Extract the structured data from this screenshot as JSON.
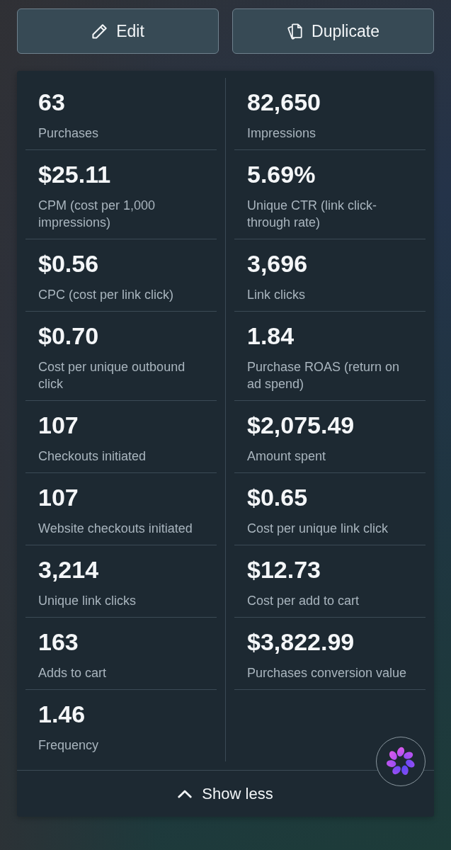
{
  "actions": [
    {
      "kind": "edit",
      "label": "Edit"
    },
    {
      "kind": "duplicate",
      "label": "Duplicate"
    }
  ],
  "metrics": {
    "columns": [
      {
        "items": [
          {
            "value": "63",
            "label": "Purchases"
          },
          {
            "value": "$25.11",
            "label": "CPM (cost per 1,000 impressions)"
          },
          {
            "value": "$0.56",
            "label": "CPC (cost per link click)"
          },
          {
            "value": "$0.70",
            "label": "Cost per unique outbound click"
          },
          {
            "value": "107",
            "label": "Checkouts initiated"
          },
          {
            "value": "107",
            "label": "Website checkouts initiated"
          },
          {
            "value": "3,214",
            "label": "Unique link clicks"
          },
          {
            "value": "163",
            "label": "Adds to cart"
          },
          {
            "value": "1.46",
            "label": "Frequency"
          }
        ]
      },
      {
        "items": [
          {
            "value": "82,650",
            "label": "Impressions"
          },
          {
            "value": "5.69%",
            "label": "Unique CTR (link click-through rate)"
          },
          {
            "value": "3,696",
            "label": "Link clicks"
          },
          {
            "value": "1.84",
            "label": "Purchase ROAS (return on ad spend)"
          },
          {
            "value": "$2,075.49",
            "label": "Amount spent"
          },
          {
            "value": "$0.65",
            "label": "Cost per unique link click"
          },
          {
            "value": "$12.73",
            "label": "Cost per add to cart"
          },
          {
            "value": "$3,822.99",
            "label": "Purchases conversion value"
          }
        ]
      }
    ]
  },
  "footer": {
    "toggle": "Show less"
  }
}
